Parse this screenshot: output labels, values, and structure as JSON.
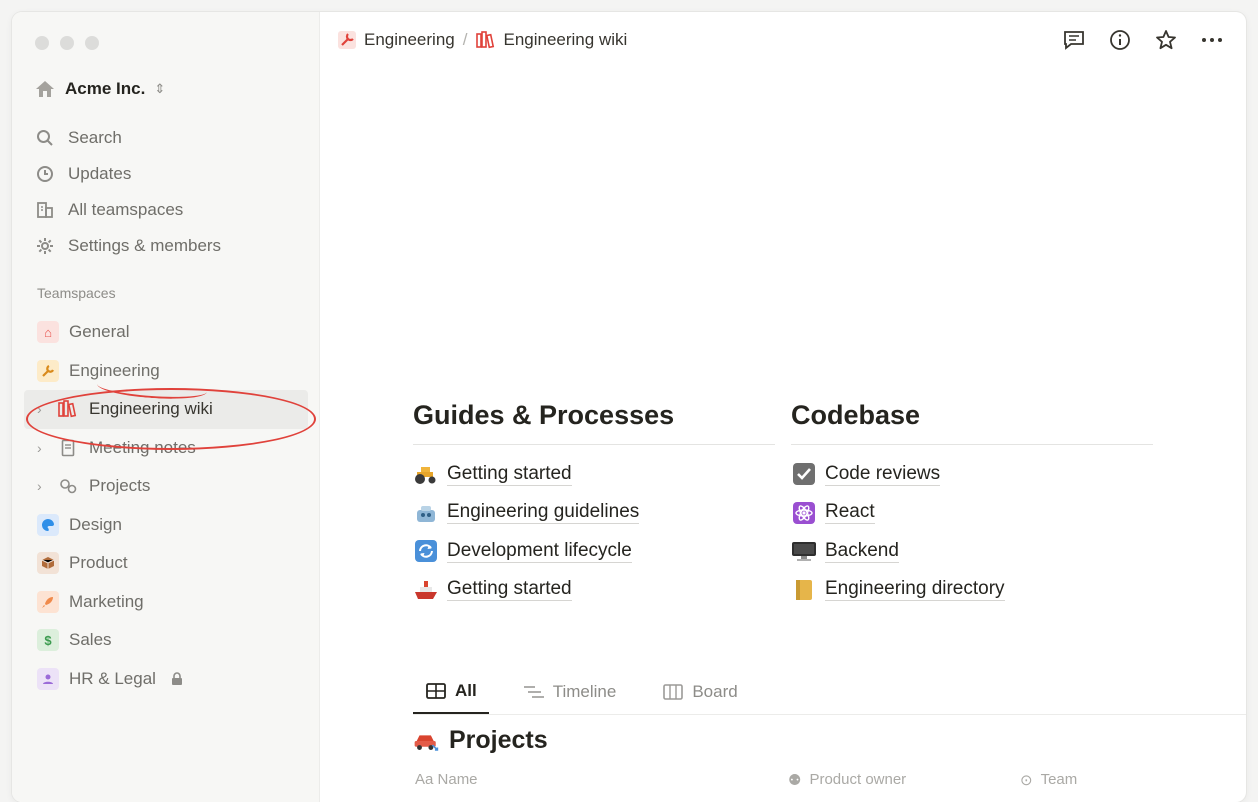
{
  "sidebar": {
    "workspace": "Acme Inc.",
    "nav": [
      {
        "icon": "search-icon",
        "label": "Search"
      },
      {
        "icon": "clock-icon",
        "label": "Updates"
      },
      {
        "icon": "building-icon",
        "label": "All teamspaces"
      },
      {
        "icon": "gear-icon",
        "label": "Settings & members"
      }
    ],
    "section_label": "Teamspaces",
    "teamspaces": [
      {
        "icon": "house-icon",
        "label": "General",
        "color": "#e9534c"
      },
      {
        "icon": "wrench-icon",
        "label": "Engineering",
        "color": "#f0a53b"
      },
      {
        "icon": "library-icon",
        "label": "Engineering wiki",
        "color": "#e0423b"
      },
      {
        "icon": "notebook-icon",
        "label": "Meeting notes",
        "color": "#8d8c88"
      },
      {
        "icon": "gears-icon",
        "label": "Projects",
        "color": "#8d8c88"
      },
      {
        "icon": "palette-icon",
        "label": "Design",
        "color": "#2f8fe8"
      },
      {
        "icon": "package-icon",
        "label": "Product",
        "color": "#b06b3a"
      },
      {
        "icon": "rocket-icon",
        "label": "Marketing",
        "color": "#f08a4b"
      },
      {
        "icon": "dollar-icon",
        "label": "Sales",
        "color": "#3c9b4f"
      },
      {
        "icon": "person-icon",
        "label": "HR & Legal",
        "color": "#9b6bd8"
      }
    ]
  },
  "breadcrumb": {
    "parent": "Engineering",
    "separator": "/",
    "current": "Engineering wiki"
  },
  "content": {
    "guides": {
      "heading": "Guides & Processes",
      "links": [
        {
          "icon": "tractor-icon",
          "label": "Getting started"
        },
        {
          "icon": "robot-icon",
          "label": "Engineering guidelines"
        },
        {
          "icon": "cycle-icon",
          "label": "Development lifecycle"
        },
        {
          "icon": "ship-icon",
          "label": "Getting started"
        }
      ]
    },
    "codebase": {
      "heading": "Codebase",
      "links": [
        {
          "icon": "checkbox-icon",
          "label": "Code reviews"
        },
        {
          "icon": "atom-icon",
          "label": "React"
        },
        {
          "icon": "desktop-icon",
          "label": "Backend"
        },
        {
          "icon": "folder-icon",
          "label": "Engineering directory"
        }
      ]
    }
  },
  "views": {
    "tabs": [
      {
        "icon": "table-icon",
        "label": "All"
      },
      {
        "icon": "timeline-icon",
        "label": "Timeline"
      },
      {
        "icon": "board-icon",
        "label": "Board"
      }
    ],
    "active": "All"
  },
  "database": {
    "title": "Projects",
    "columns": [
      "Aa Name",
      "Product owner",
      "Team"
    ]
  }
}
